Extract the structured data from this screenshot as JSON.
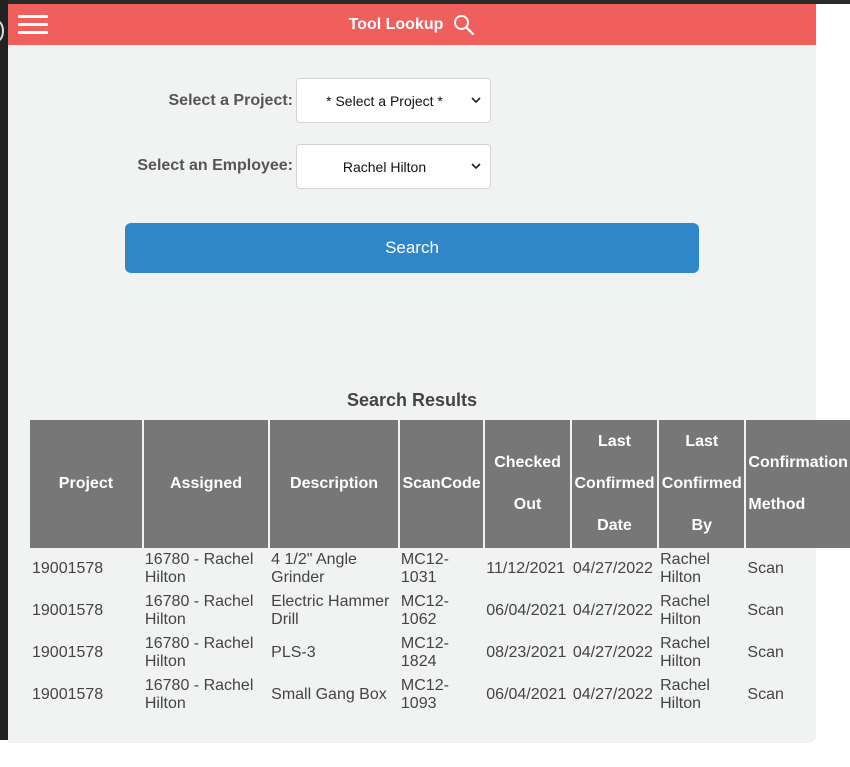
{
  "header": {
    "title": "Tool Lookup"
  },
  "form": {
    "project_label": "Select a Project:",
    "project_value": "* Select a Project *",
    "employee_label": "Select an Employee:",
    "employee_value": "Rachel Hilton",
    "search_label": "Search"
  },
  "results": {
    "title": "Search Results",
    "columns": [
      "Project",
      "Assigned",
      "Description",
      "ScanCode",
      "Checked Out",
      "Last Confirmed Date",
      "Last Confirmed By",
      "Confirmation Method"
    ],
    "rows": [
      {
        "project": "19001578",
        "assigned_1": "16780 - Rachel",
        "assigned_2": "Hilton",
        "desc_1": "4 1/2\" Angle",
        "desc_2": "Grinder",
        "scan_1": "MC12-",
        "scan_2": "1031",
        "checked_out": "11/12/2021",
        "confirmed_date": "04/27/2022",
        "by_1": "Rachel",
        "by_2": "Hilton",
        "method": "Scan"
      },
      {
        "project": "19001578",
        "assigned_1": "16780 - Rachel",
        "assigned_2": "Hilton",
        "desc_1": "Electric Hammer",
        "desc_2": "Drill",
        "scan_1": "MC12-",
        "scan_2": "1062",
        "checked_out": "06/04/2021",
        "confirmed_date": "04/27/2022",
        "by_1": "Rachel",
        "by_2": "Hilton",
        "method": "Scan"
      },
      {
        "project": "19001578",
        "assigned_1": "16780 - Rachel",
        "assigned_2": "Hilton",
        "desc_1": "PLS-3",
        "desc_2": "",
        "scan_1": "MC12-",
        "scan_2": "1824",
        "checked_out": "08/23/2021",
        "confirmed_date": "04/27/2022",
        "by_1": "Rachel",
        "by_2": "Hilton",
        "method": "Scan"
      },
      {
        "project": "19001578",
        "assigned_1": "16780 - Rachel",
        "assigned_2": "Hilton",
        "desc_1": "Small Gang Box",
        "desc_2": "",
        "scan_1": "MC12-",
        "scan_2": "1093",
        "checked_out": "06/04/2021",
        "confirmed_date": "04/27/2022",
        "by_1": "Rachel",
        "by_2": "Hilton",
        "method": "Scan"
      }
    ]
  },
  "icons": {
    "menu": "hamburger-menu-icon",
    "title": "search-icon",
    "dropdown": "chevron-down-icon"
  },
  "colors": {
    "header": "#f05f5b",
    "button": "#2f86c9",
    "table_header": "#777777",
    "background": "#f1f2f2"
  }
}
